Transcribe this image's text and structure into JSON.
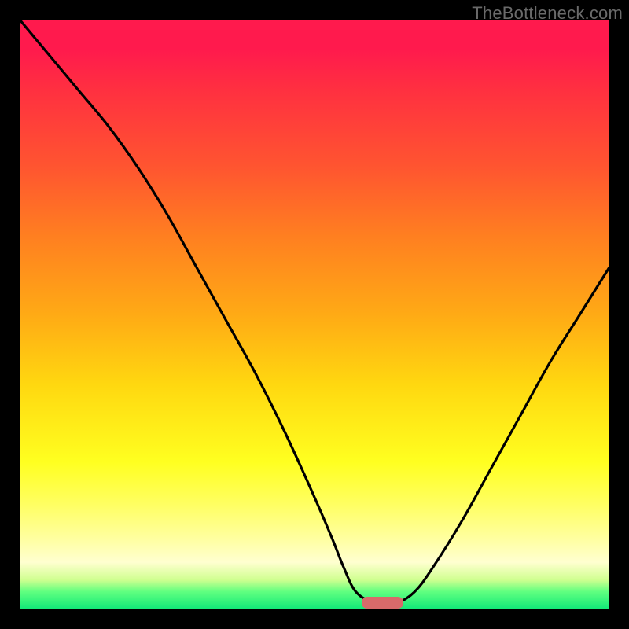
{
  "watermark": "TheBottleneck.com",
  "chart_data": {
    "type": "line",
    "title": "",
    "xlabel": "",
    "ylabel": "",
    "xlim": [
      0,
      100
    ],
    "ylim": [
      0,
      100
    ],
    "series": [
      {
        "name": "bottleneck-curve",
        "x": [
          0,
          5,
          10,
          15,
          20,
          25,
          30,
          35,
          40,
          45,
          50,
          53,
          55,
          57,
          60,
          62,
          64,
          67,
          70,
          75,
          80,
          85,
          90,
          95,
          100
        ],
        "values": [
          100,
          94,
          88,
          82,
          75,
          67,
          58,
          49,
          40,
          30,
          19,
          12,
          7,
          3,
          1,
          0.5,
          1,
          3,
          7,
          15,
          24,
          33,
          42,
          50,
          58
        ]
      }
    ],
    "marker": {
      "x_center": 61.5,
      "width": 7,
      "height": 2,
      "color": "#d86a6a"
    },
    "background_gradient": {
      "top": "#ff1a4d",
      "mid": "#ffd810",
      "bottom": "#10e878"
    }
  }
}
